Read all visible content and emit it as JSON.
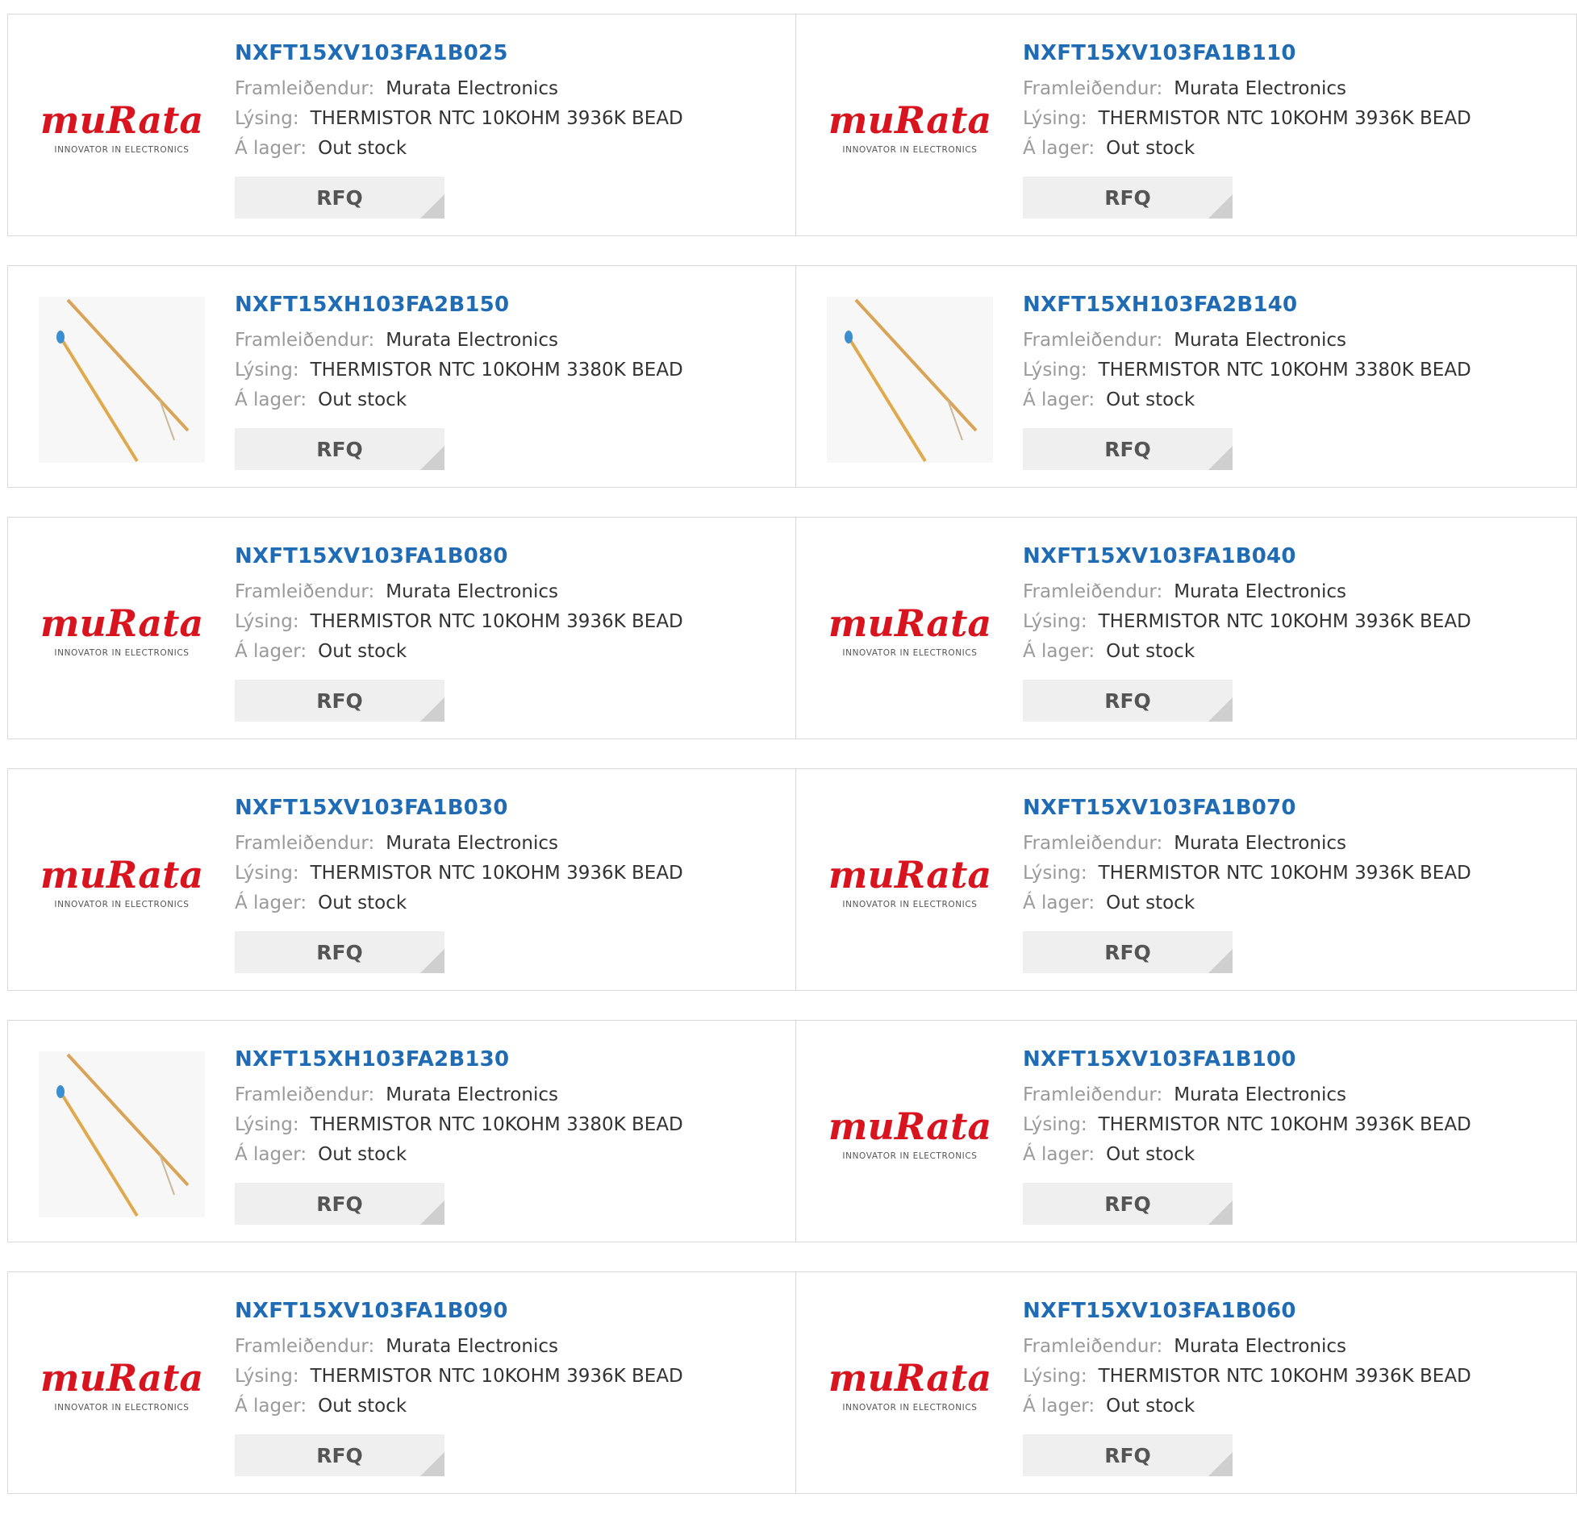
{
  "labels": {
    "manufacturer": "Framleiðendur:",
    "description": "Lýsing:",
    "stock": "Á lager:",
    "rfq": "RFQ"
  },
  "logo": {
    "brand": "muRata",
    "tagline": "INNOVATOR IN ELECTRONICS",
    "color": "#d8141e"
  },
  "products": [
    {
      "part": "NXFT15XV103FA1B025",
      "manufacturer": "Murata Electronics",
      "description": "THERMISTOR NTC 10KOHM 3936K BEAD",
      "stock": "Out stock",
      "image": "murata-logo"
    },
    {
      "part": "NXFT15XV103FA1B110",
      "manufacturer": "Murata Electronics",
      "description": "THERMISTOR NTC 10KOHM 3936K BEAD",
      "stock": "Out stock",
      "image": "murata-logo"
    },
    {
      "part": "NXFT15XH103FA2B150",
      "manufacturer": "Murata Electronics",
      "description": "THERMISTOR NTC 10KOHM 3380K BEAD",
      "stock": "Out stock",
      "image": "thermistor-photo"
    },
    {
      "part": "NXFT15XH103FA2B140",
      "manufacturer": "Murata Electronics",
      "description": "THERMISTOR NTC 10KOHM 3380K BEAD",
      "stock": "Out stock",
      "image": "thermistor-photo"
    },
    {
      "part": "NXFT15XV103FA1B080",
      "manufacturer": "Murata Electronics",
      "description": "THERMISTOR NTC 10KOHM 3936K BEAD",
      "stock": "Out stock",
      "image": "murata-logo"
    },
    {
      "part": "NXFT15XV103FA1B040",
      "manufacturer": "Murata Electronics",
      "description": "THERMISTOR NTC 10KOHM 3936K BEAD",
      "stock": "Out stock",
      "image": "murata-logo"
    },
    {
      "part": "NXFT15XV103FA1B030",
      "manufacturer": "Murata Electronics",
      "description": "THERMISTOR NTC 10KOHM 3936K BEAD",
      "stock": "Out stock",
      "image": "murata-logo"
    },
    {
      "part": "NXFT15XV103FA1B070",
      "manufacturer": "Murata Electronics",
      "description": "THERMISTOR NTC 10KOHM 3936K BEAD",
      "stock": "Out stock",
      "image": "murata-logo"
    },
    {
      "part": "NXFT15XH103FA2B130",
      "manufacturer": "Murata Electronics",
      "description": "THERMISTOR NTC 10KOHM 3380K BEAD",
      "stock": "Out stock",
      "image": "thermistor-photo"
    },
    {
      "part": "NXFT15XV103FA1B100",
      "manufacturer": "Murata Electronics",
      "description": "THERMISTOR NTC 10KOHM 3936K BEAD",
      "stock": "Out stock",
      "image": "murata-logo"
    },
    {
      "part": "NXFT15XV103FA1B090",
      "manufacturer": "Murata Electronics",
      "description": "THERMISTOR NTC 10KOHM 3936K BEAD",
      "stock": "Out stock",
      "image": "murata-logo"
    },
    {
      "part": "NXFT15XV103FA1B060",
      "manufacturer": "Murata Electronics",
      "description": "THERMISTOR NTC 10KOHM 3936K BEAD",
      "stock": "Out stock",
      "image": "murata-logo"
    }
  ]
}
